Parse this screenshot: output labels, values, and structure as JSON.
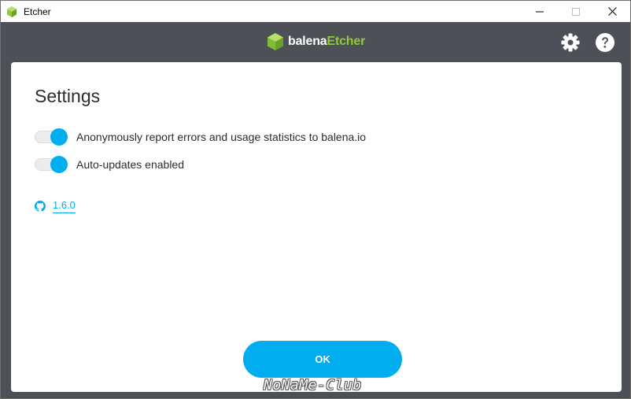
{
  "window": {
    "title": "Etcher",
    "controls": [
      "minimize",
      "maximize",
      "close"
    ]
  },
  "header": {
    "brand_part1": "balena",
    "brand_part2": "Etcher",
    "icons": [
      "gear-icon",
      "help-icon"
    ]
  },
  "settings": {
    "title": "Settings",
    "options": [
      {
        "label": "Anonymously report errors and usage statistics to balena.io",
        "enabled": true
      },
      {
        "label": "Auto-updates enabled",
        "enabled": true
      }
    ],
    "version": "1.6.0",
    "ok_label": "OK"
  },
  "watermark": "NoNaMe-Club",
  "colors": {
    "header_bg": "#4d5057",
    "accent": "#00aeef",
    "brand_green": "#8fca3b",
    "panel_bg": "#ffffff",
    "text": "#2a2c31"
  }
}
